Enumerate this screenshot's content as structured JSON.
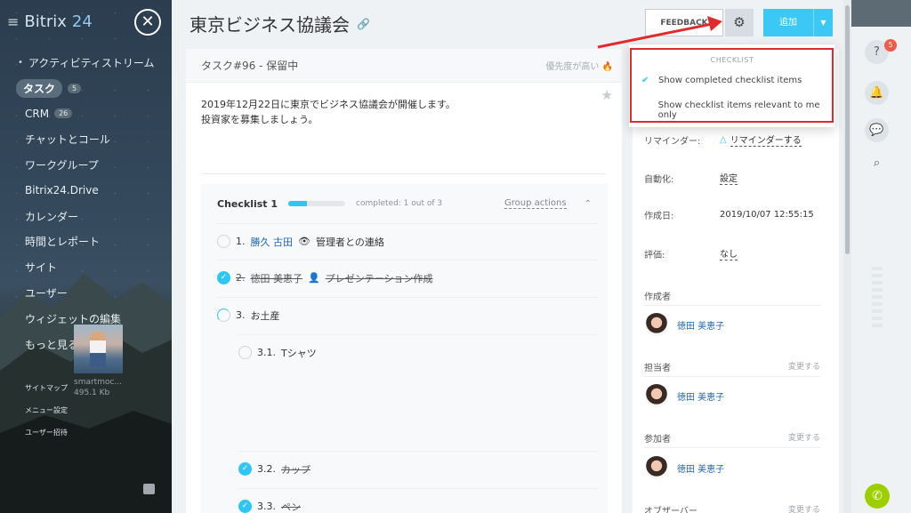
{
  "app": {
    "logo_main": "Bitrix",
    "logo_num": "24",
    "menu_icon": "hamburger-icon",
    "close_icon": "close-icon"
  },
  "sidebar": {
    "items": [
      {
        "label": "アクティビティストリーム"
      },
      {
        "label": "タスク",
        "count": "5"
      },
      {
        "label": "CRM",
        "count": "26"
      },
      {
        "label": "チャットとコール"
      },
      {
        "label": "ワークグループ"
      },
      {
        "label": "Bitrix24.Drive"
      },
      {
        "label": "カレンダー"
      },
      {
        "label": "時間とレポート"
      },
      {
        "label": "サイト"
      },
      {
        "label": "ユーザー"
      },
      {
        "label": "ウィジェットの編集"
      },
      {
        "label": "もっと見る..."
      }
    ],
    "small": [
      "サイトマップ",
      "メニュー設定",
      "ユーザー招待"
    ]
  },
  "header": {
    "title": "東京ビジネス協議会",
    "feedback": "FEEDBACK",
    "add": "追加"
  },
  "task": {
    "id_status": "タスク#96 - 保留中",
    "priority": "優先度が高い",
    "desc1": "2019年12月22日に東京でビジネス協議会が開催します。",
    "desc2": "投資家を募集しましょう。"
  },
  "checklist": {
    "title": "Checklist 1",
    "progress": 0.33,
    "completed": "completed: 1 out of 3",
    "group_actions": "Group actions",
    "items": [
      {
        "num": "1.",
        "user": "勝久 古田",
        "text": "管理者との連絡",
        "state": "open"
      },
      {
        "num": "2.",
        "user": "徳田 美恵子",
        "text": "プレゼンテーション作成",
        "state": "done"
      },
      {
        "num": "3.",
        "user": "",
        "text": "お土産",
        "state": "partial"
      },
      {
        "num": "3.1.",
        "user": "",
        "text": "Tシャツ",
        "state": "open"
      },
      {
        "num": "3.2.",
        "user": "",
        "text": "カップ",
        "state": "done"
      },
      {
        "num": "3.3.",
        "user": "",
        "text": "ペン",
        "state": "done"
      }
    ],
    "file": {
      "name": "smartmoc...",
      "size": "495.1 Kb"
    }
  },
  "dropdown": {
    "header": "CHECKLIST",
    "opt1": "Show completed checklist items",
    "opt2": "Show checklist items relevant to me only"
  },
  "details": {
    "reminder_label": "リマインダー:",
    "reminder_value": "リマインダーする",
    "auto_label": "自動化:",
    "auto_value": "設定",
    "created_label": "作成日:",
    "created_value": "2019/10/07 12:55:15",
    "rating_label": "評価:",
    "rating_value": "なし",
    "creator_label": "作成者",
    "creator": "徳田 美恵子",
    "assignee_label": "担当者",
    "assignee": "徳田 美恵子",
    "change": "変更する",
    "participants_label": "参加者",
    "participant": "徳田 美恵子",
    "observers_label": "オブザーバー"
  },
  "right": {
    "notif_count": "5"
  },
  "colors": {
    "accent": "#2fc6f6",
    "red": "#e02b2b",
    "add": "#3bc8f5"
  }
}
